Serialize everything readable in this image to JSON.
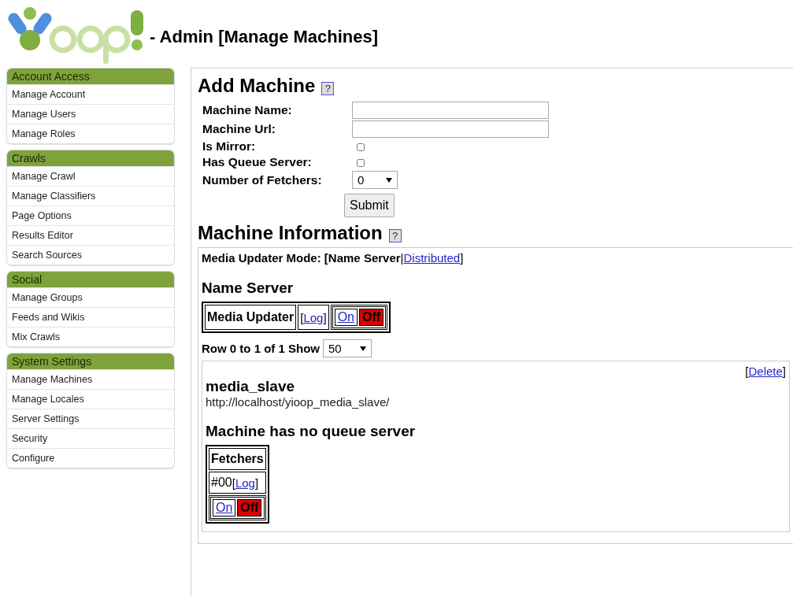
{
  "header": {
    "title": "- Admin [Manage Machines]"
  },
  "sidebar": {
    "groups": [
      {
        "title": "Account Access",
        "items": [
          "Manage Account",
          "Manage Users",
          "Manage Roles"
        ]
      },
      {
        "title": "Crawls",
        "items": [
          "Manage Crawl",
          "Manage Classifiers",
          "Page Options",
          "Results Editor",
          "Search Sources"
        ]
      },
      {
        "title": "Social",
        "items": [
          "Manage Groups",
          "Feeds and Wikis",
          "Mix Crawls"
        ]
      },
      {
        "title": "System Settings",
        "items": [
          "Manage Machines",
          "Manage Locales",
          "Server Settings",
          "Security",
          "Configure"
        ]
      }
    ]
  },
  "add_machine": {
    "heading": "Add Machine",
    "help": "?",
    "fields": [
      {
        "kind": "text",
        "label": "Machine Name:"
      },
      {
        "kind": "text",
        "label": "Machine Url:"
      },
      {
        "kind": "checkbox",
        "label": "Is Mirror:",
        "checked": false
      },
      {
        "kind": "checkbox",
        "label": "Has Queue Server:",
        "checked": false
      },
      {
        "kind": "select",
        "label": "Number of Fetchers:",
        "value": "0"
      }
    ],
    "submit": "Submit"
  },
  "machine_information": {
    "heading": "Machine Information",
    "help": "?",
    "mode": {
      "label": "Media Updater Mode:",
      "open": "[",
      "separator": "|",
      "close": "]",
      "options": [
        {
          "label": "Name Server",
          "selected": true
        },
        {
          "label": "Distributed",
          "selected": false
        }
      ]
    },
    "name_server": {
      "heading": "Name Server",
      "process": "Media Updater",
      "log": {
        "open": "[",
        "label": "Log",
        "close": "]"
      },
      "toggle": {
        "on_label": "On",
        "off_label": "Off",
        "on": false
      }
    },
    "paging": {
      "label": "Row 0 to 1 of 1 Show",
      "value": "50"
    },
    "machines": [
      {
        "delete": {
          "open": "[",
          "label": "Delete",
          "close": "]"
        },
        "name": "media_slave",
        "url": "http://localhost/yioop_media_slave/",
        "queue_status": "Machine has no queue server",
        "fetchers_heading": "Fetchers",
        "fetchers": [
          {
            "id": "#00",
            "log": {
              "open": "[",
              "label": "Log",
              "close": "]"
            },
            "toggle": {
              "on_label": "On",
              "off_label": "Off",
              "on": false
            }
          }
        ]
      }
    ]
  }
}
